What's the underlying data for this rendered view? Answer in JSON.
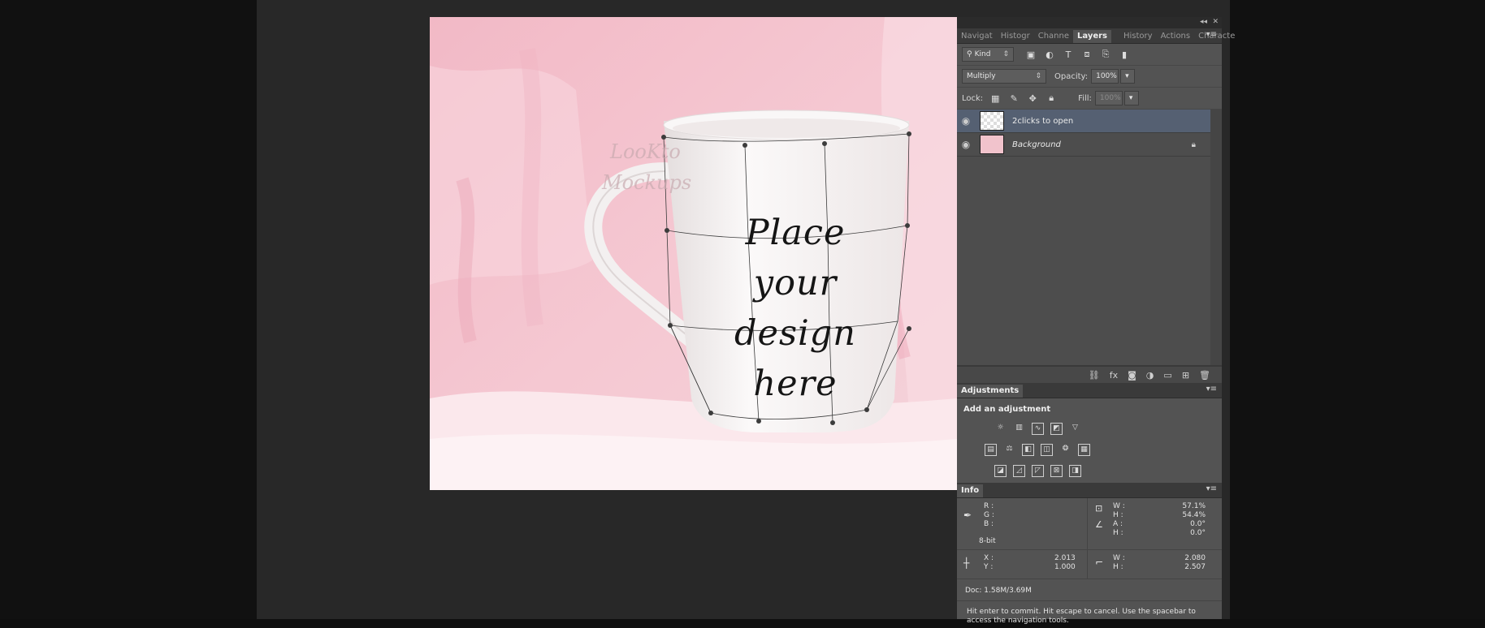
{
  "panel_tabs": [
    {
      "label": "Navigat",
      "active": false
    },
    {
      "label": "Histogr",
      "active": false
    },
    {
      "label": "Channe",
      "active": false
    },
    {
      "label": "Layers",
      "active": true
    },
    {
      "label": "History",
      "active": false
    },
    {
      "label": "Actions",
      "active": false
    },
    {
      "label": "Characte",
      "active": false
    }
  ],
  "canvas": {
    "design_text": [
      "Place",
      "your",
      "design",
      "here"
    ],
    "watermark": [
      "LooKto",
      "Mockups"
    ]
  },
  "layers_panel": {
    "filter_kind": "Kind",
    "blend_mode": "Multiply",
    "opacity_label": "Opacity:",
    "opacity_value": "100%",
    "lock_label": "Lock:",
    "fill_label": "Fill:",
    "fill_value": "100%",
    "layers": [
      {
        "name": "2clicks to open",
        "selected": true,
        "italic": false,
        "locked": false
      },
      {
        "name": "Background",
        "selected": false,
        "italic": true,
        "locked": true
      }
    ]
  },
  "adjustments": {
    "tab": "Adjustments",
    "title": "Add an adjustment"
  },
  "info": {
    "tab": "Info",
    "rgb_labels": [
      "R :",
      "G :",
      "B :"
    ],
    "bit_depth": "8-bit",
    "transform": {
      "w_label": "W :",
      "w": "57.1%",
      "h_label": "H :",
      "h": "54.4%",
      "a_label": "A :",
      "a": "0.0°",
      "h2_label": "H :",
      "h2": "0.0°"
    },
    "xy": {
      "x_label": "X :",
      "x": "2.013",
      "y_label": "Y :",
      "y": "1.000"
    },
    "size": {
      "w_label": "W :",
      "w": "2.080",
      "h_label": "H :",
      "h": "2.507"
    },
    "doc": "Doc: 1.58M/3.69M",
    "hint": "Hit enter to commit. Hit escape to cancel. Use the spacebar to access the navigation tools."
  }
}
